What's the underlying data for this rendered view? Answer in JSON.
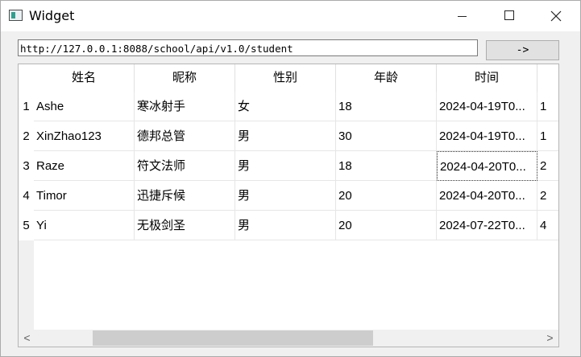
{
  "window": {
    "title": "Widget",
    "min_icon": "minimize-icon",
    "max_icon": "maximize-icon",
    "close_icon": "close-icon"
  },
  "request": {
    "url": "http://127.0.0.1:8088/school/api/v1.0/student",
    "go_label": "->"
  },
  "table": {
    "columns": [
      "姓名",
      "昵称",
      "性别",
      "年龄",
      "时间",
      ""
    ],
    "rows": [
      {
        "num": "1",
        "cells": [
          "Ashe",
          "寒冰射手",
          "女",
          "18",
          "2024-04-19T0...",
          "1"
        ]
      },
      {
        "num": "2",
        "cells": [
          "XinZhao123",
          "德邦总管",
          "男",
          "30",
          "2024-04-19T0...",
          "1"
        ]
      },
      {
        "num": "3",
        "cells": [
          "Raze",
          "符文法师",
          "男",
          "18",
          "2024-04-20T0...",
          "2"
        ]
      },
      {
        "num": "4",
        "cells": [
          "Timor",
          "迅捷斥候",
          "男",
          "20",
          "2024-04-20T0...",
          "2"
        ]
      },
      {
        "num": "5",
        "cells": [
          "Yi",
          "无极剑圣",
          "男",
          "20",
          "2024-07-22T0...",
          "4"
        ]
      }
    ],
    "focused_cell": {
      "row": 2,
      "col": 4
    }
  },
  "scrollbar": {
    "left_arrow": "<",
    "right_arrow": ">",
    "left_icon": "scroll-left-icon",
    "right_icon": "scroll-right-icon"
  }
}
